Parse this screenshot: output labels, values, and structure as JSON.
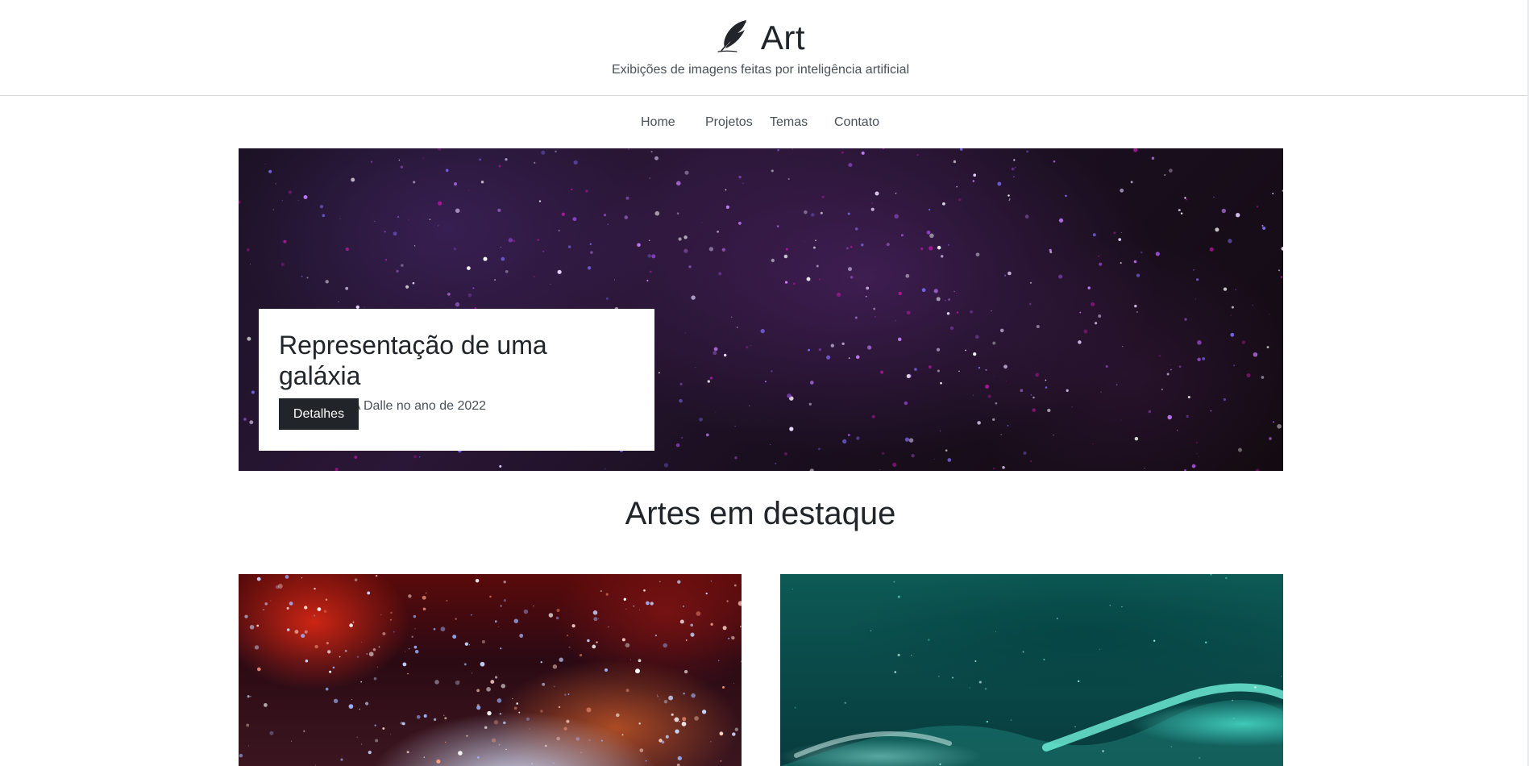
{
  "header": {
    "title": "Art",
    "tagline": "Exibições de imagens feitas por inteligência artificial",
    "logo_icon": "feather-icon"
  },
  "nav": {
    "items": [
      {
        "label": "Home"
      },
      {
        "label": "Projetos"
      },
      {
        "label": "Temas"
      },
      {
        "label": "Contato"
      }
    ]
  },
  "hero": {
    "title": "Representação de uma galáxia",
    "subtitle": "Criada pela IA Dalle no ano de 2022",
    "button_label": "Detalhes"
  },
  "featured": {
    "title": "Artes em destaque"
  },
  "colors": {
    "text": "#212529",
    "muted": "#495057",
    "button_bg": "#212529",
    "border": "#d6d8db"
  }
}
